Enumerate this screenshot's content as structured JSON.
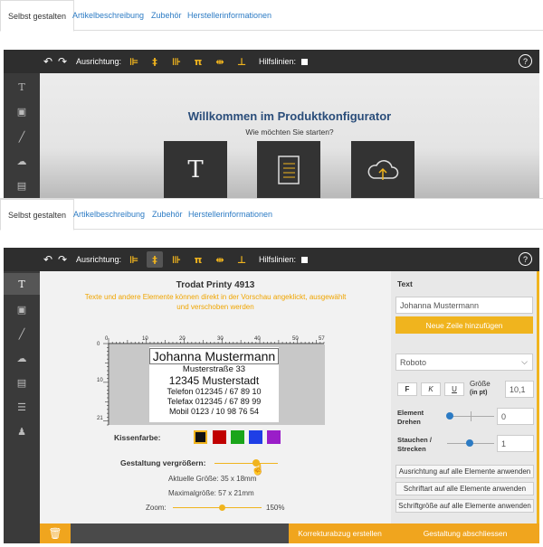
{
  "tabs": [
    "Selbst gestalten",
    "Artikelbeschreibung",
    "Zubehör",
    "Herstellerinformationen"
  ],
  "toolbar": {
    "alignment_label": "Ausrichtung:",
    "guides_label": "Hilfslinien:",
    "help": "?"
  },
  "welcome": {
    "title": "Willkommen im Produktkonfigurator",
    "subtitle": "Wie möchten Sie starten?",
    "icon_text": "T"
  },
  "product": {
    "title": "Trodat Printy 4913",
    "hint": "Texte und andere Elemente können direkt in der Vorschau angeklickt, ausgewählt und verschoben werden",
    "ruler_top": [
      "0",
      "10",
      "20",
      "30",
      "40",
      "50",
      "57"
    ],
    "ruler_left": [
      "0",
      "10",
      "21"
    ],
    "lines": [
      "Johanna Mustermann",
      "Musterstraße 33",
      "12345 Musterstadt",
      "Telefon 012345 / 67 89 10",
      "Telefax 012345 / 67 89 99",
      "Mobil 0123 / 10 98 76 54"
    ],
    "pad_color_label": "Kissenfarbe:",
    "pad_colors": [
      "#111111",
      "#c00000",
      "#1aa51a",
      "#1f3fe6",
      "#9a1ec8"
    ],
    "enlarge_label": "Gestaltung vergrößern:",
    "enlarge_fraction": 0.65,
    "current_size": "Aktuelle Größe: 35 x 18mm",
    "max_size": "Maximalgröße: 57 x 21mm",
    "zoom_label": "Zoom:",
    "zoom_value": "150%",
    "zoom_fraction": 0.55
  },
  "panel": {
    "section": "Text",
    "text_value": "Johanna Mustermann",
    "add_line": "Neue Zeile hinzufügen",
    "font": "Roboto",
    "bold": "F",
    "italic": "K",
    "underline": "U",
    "size_label": "Größe",
    "size_unit": "(in pt)",
    "size_value": "10,1",
    "rotate_label_1": "Element",
    "rotate_label_2": "Drehen",
    "rotate_value": "0",
    "stretch_label_1": "Stauchen /",
    "stretch_label_2": "Strecken",
    "stretch_value": "1",
    "apply_align": "Ausrichtung auf alle Elemente anwenden",
    "apply_font": "Schriftart auf alle Elemente anwenden",
    "apply_size": "Schriftgröße auf alle Elemente anwenden"
  },
  "footer": {
    "proof": "Korrekturabzug erstellen",
    "finish": "Gestaltung abschliessen"
  }
}
